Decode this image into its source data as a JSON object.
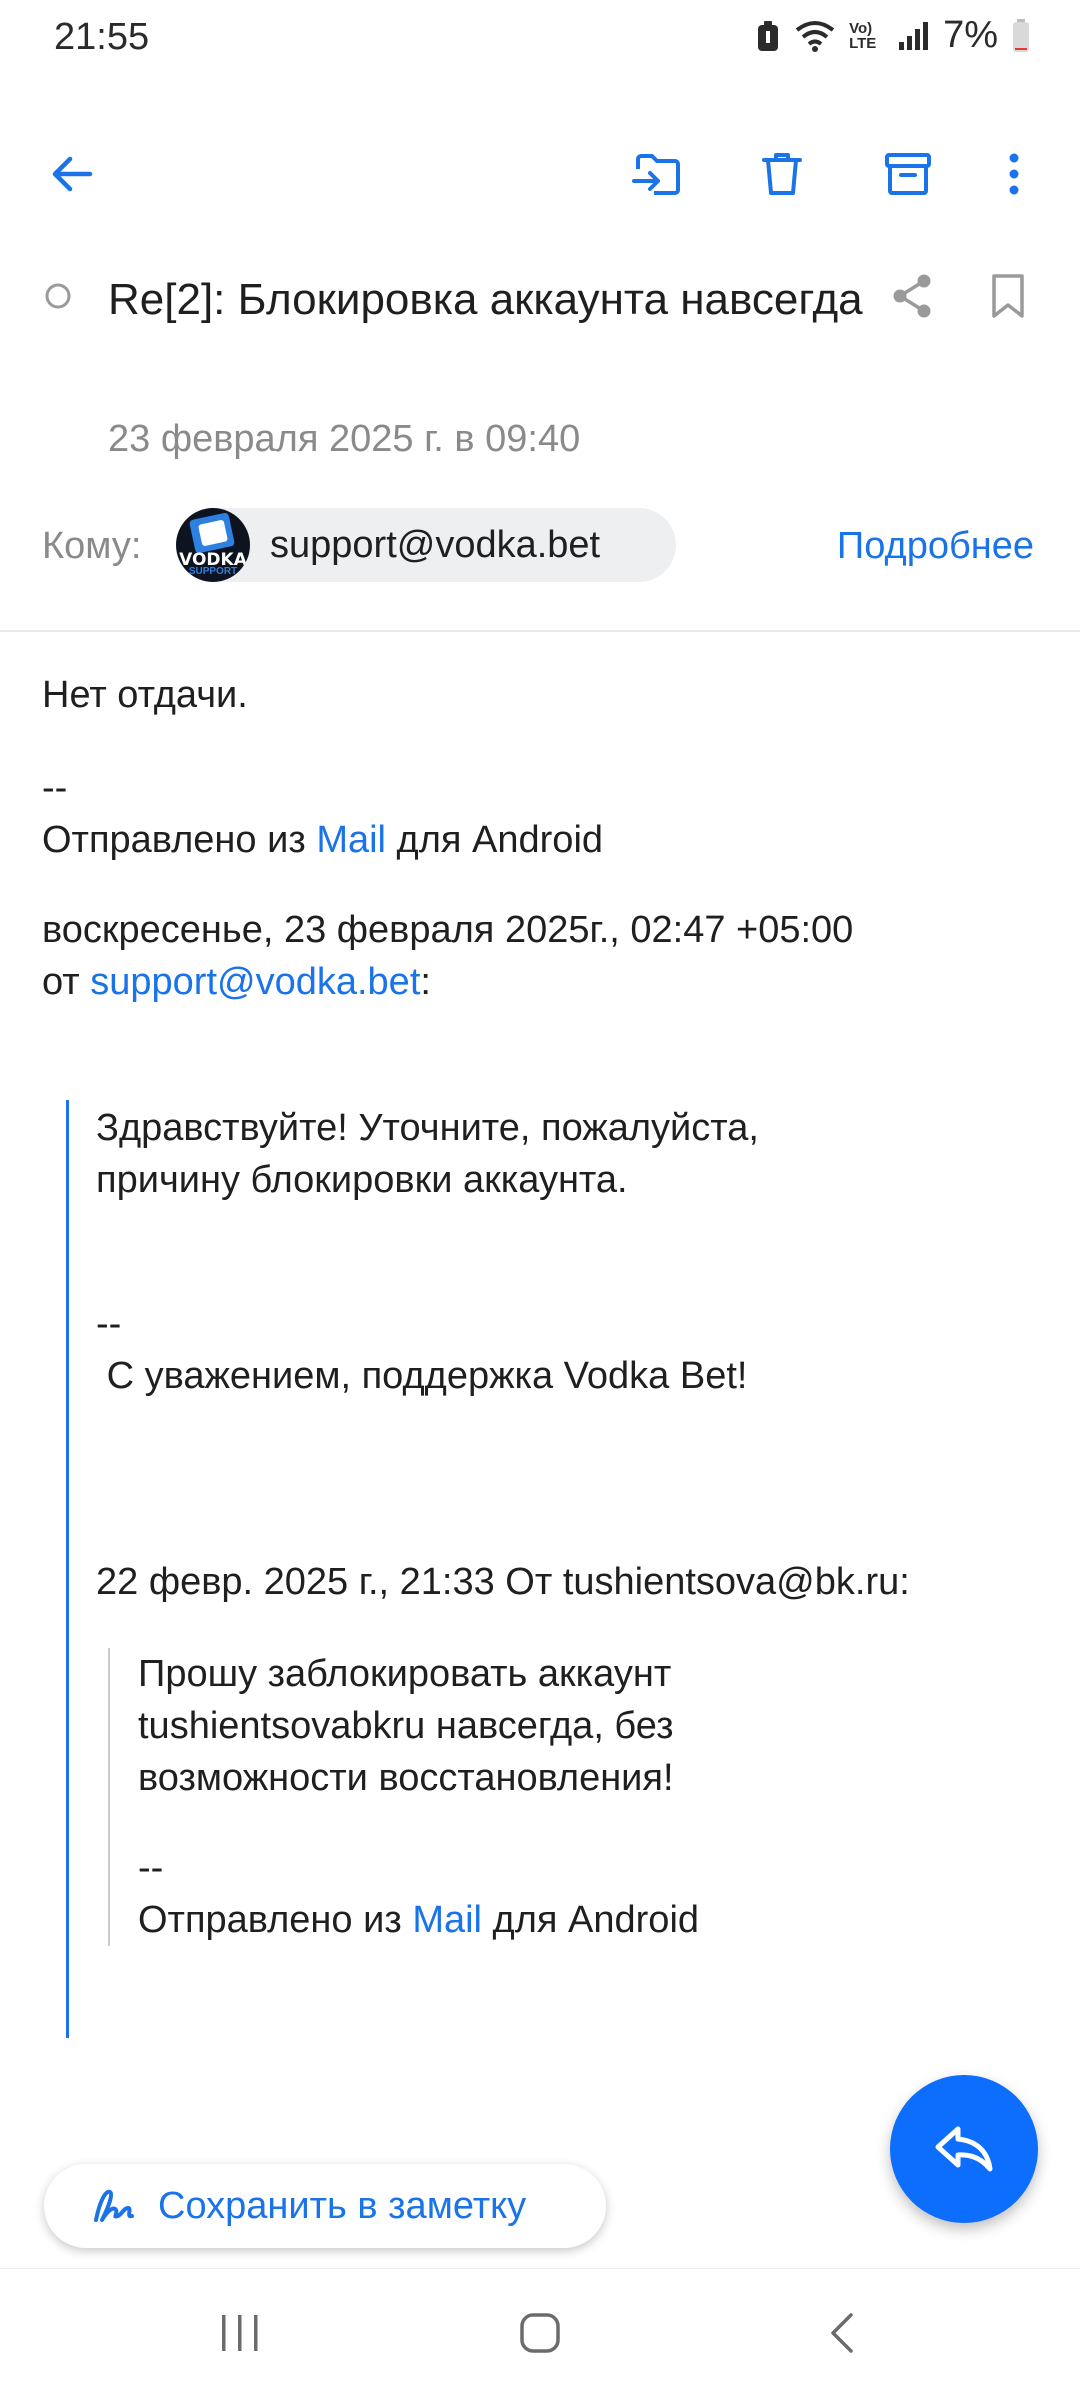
{
  "status_bar": {
    "time": "21:55",
    "network_label": "Vo) LTE",
    "battery": "7%"
  },
  "toolbar": {
    "icons": [
      "back-arrow-icon",
      "move-to-folder-icon",
      "trash-icon",
      "archive-icon",
      "more-vert-icon"
    ]
  },
  "header": {
    "subject": "Re[2]: Блокировка аккаунта навсегда",
    "date": "23 февраля 2025 г. в 09:40",
    "to_label": "Кому:",
    "recipient_email": "support@vodka.bet",
    "recipient_avatar_text": "VODKA",
    "recipient_avatar_subtext": "SUPPORT",
    "details_link": "Подробнее"
  },
  "message": {
    "body": "Нет отдачи.",
    "signature_dashes": "--",
    "sent_from_prefix": "Отправлено из ",
    "sent_from_app": "Mail",
    "sent_from_suffix": " для Android",
    "reply_header_line1": "воскресенье, 23 февраля 2025г., 02:47 +05:00",
    "reply_header_from": "от ",
    "reply_header_email": "support@vodka.bet",
    "reply_header_colon": ":"
  },
  "quote1": {
    "text": "Здравствуйте! Уточните, пожалуйста,\nпричину блокировки аккаунта.",
    "dashes": "--",
    "signature": " С уважением, поддержка Vodka Bet!",
    "nested_header": "22 февр. 2025 г., 21:33 От tushientsova@bk.ru:"
  },
  "quote2": {
    "text": "Прошу заблокировать аккаунт\ntushientsovabkru навсегда, без\nвозможности восстановления!",
    "dashes": "--",
    "sent_from_prefix": "Отправлено из ",
    "sent_from_app": "Mail",
    "sent_from_suffix": " для Android"
  },
  "actions": {
    "save_note_label": "Сохранить в заметку",
    "reply_fab_icon": "reply-icon"
  },
  "colors": {
    "accent": "#1a73e8",
    "fab": "#0d6efd",
    "muted": "#8a8a8a"
  }
}
